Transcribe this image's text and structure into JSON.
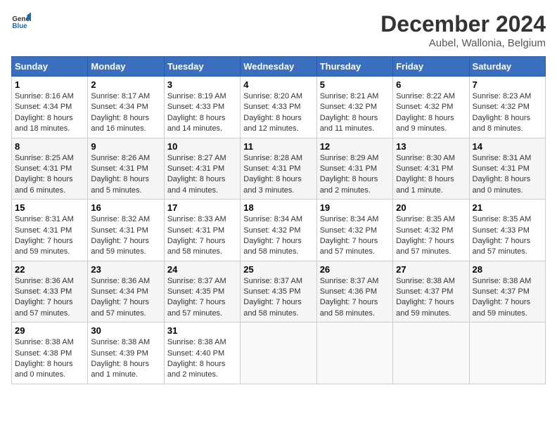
{
  "header": {
    "logo_general": "General",
    "logo_blue": "Blue",
    "title": "December 2024",
    "subtitle": "Aubel, Wallonia, Belgium"
  },
  "days_of_week": [
    "Sunday",
    "Monday",
    "Tuesday",
    "Wednesday",
    "Thursday",
    "Friday",
    "Saturday"
  ],
  "weeks": [
    [
      {
        "day": "1",
        "sunrise": "8:16 AM",
        "sunset": "4:34 PM",
        "daylight": "8 hours and 18 minutes."
      },
      {
        "day": "2",
        "sunrise": "8:17 AM",
        "sunset": "4:34 PM",
        "daylight": "8 hours and 16 minutes."
      },
      {
        "day": "3",
        "sunrise": "8:19 AM",
        "sunset": "4:33 PM",
        "daylight": "8 hours and 14 minutes."
      },
      {
        "day": "4",
        "sunrise": "8:20 AM",
        "sunset": "4:33 PM",
        "daylight": "8 hours and 12 minutes."
      },
      {
        "day": "5",
        "sunrise": "8:21 AM",
        "sunset": "4:32 PM",
        "daylight": "8 hours and 11 minutes."
      },
      {
        "day": "6",
        "sunrise": "8:22 AM",
        "sunset": "4:32 PM",
        "daylight": "8 hours and 9 minutes."
      },
      {
        "day": "7",
        "sunrise": "8:23 AM",
        "sunset": "4:32 PM",
        "daylight": "8 hours and 8 minutes."
      }
    ],
    [
      {
        "day": "8",
        "sunrise": "8:25 AM",
        "sunset": "4:31 PM",
        "daylight": "8 hours and 6 minutes."
      },
      {
        "day": "9",
        "sunrise": "8:26 AM",
        "sunset": "4:31 PM",
        "daylight": "8 hours and 5 minutes."
      },
      {
        "day": "10",
        "sunrise": "8:27 AM",
        "sunset": "4:31 PM",
        "daylight": "8 hours and 4 minutes."
      },
      {
        "day": "11",
        "sunrise": "8:28 AM",
        "sunset": "4:31 PM",
        "daylight": "8 hours and 3 minutes."
      },
      {
        "day": "12",
        "sunrise": "8:29 AM",
        "sunset": "4:31 PM",
        "daylight": "8 hours and 2 minutes."
      },
      {
        "day": "13",
        "sunrise": "8:30 AM",
        "sunset": "4:31 PM",
        "daylight": "8 hours and 1 minute."
      },
      {
        "day": "14",
        "sunrise": "8:31 AM",
        "sunset": "4:31 PM",
        "daylight": "8 hours and 0 minutes."
      }
    ],
    [
      {
        "day": "15",
        "sunrise": "8:31 AM",
        "sunset": "4:31 PM",
        "daylight": "7 hours and 59 minutes."
      },
      {
        "day": "16",
        "sunrise": "8:32 AM",
        "sunset": "4:31 PM",
        "daylight": "7 hours and 59 minutes."
      },
      {
        "day": "17",
        "sunrise": "8:33 AM",
        "sunset": "4:31 PM",
        "daylight": "7 hours and 58 minutes."
      },
      {
        "day": "18",
        "sunrise": "8:34 AM",
        "sunset": "4:32 PM",
        "daylight": "7 hours and 58 minutes."
      },
      {
        "day": "19",
        "sunrise": "8:34 AM",
        "sunset": "4:32 PM",
        "daylight": "7 hours and 57 minutes."
      },
      {
        "day": "20",
        "sunrise": "8:35 AM",
        "sunset": "4:32 PM",
        "daylight": "7 hours and 57 minutes."
      },
      {
        "day": "21",
        "sunrise": "8:35 AM",
        "sunset": "4:33 PM",
        "daylight": "7 hours and 57 minutes."
      }
    ],
    [
      {
        "day": "22",
        "sunrise": "8:36 AM",
        "sunset": "4:33 PM",
        "daylight": "7 hours and 57 minutes."
      },
      {
        "day": "23",
        "sunrise": "8:36 AM",
        "sunset": "4:34 PM",
        "daylight": "7 hours and 57 minutes."
      },
      {
        "day": "24",
        "sunrise": "8:37 AM",
        "sunset": "4:35 PM",
        "daylight": "7 hours and 57 minutes."
      },
      {
        "day": "25",
        "sunrise": "8:37 AM",
        "sunset": "4:35 PM",
        "daylight": "7 hours and 58 minutes."
      },
      {
        "day": "26",
        "sunrise": "8:37 AM",
        "sunset": "4:36 PM",
        "daylight": "7 hours and 58 minutes."
      },
      {
        "day": "27",
        "sunrise": "8:38 AM",
        "sunset": "4:37 PM",
        "daylight": "7 hours and 59 minutes."
      },
      {
        "day": "28",
        "sunrise": "8:38 AM",
        "sunset": "4:37 PM",
        "daylight": "7 hours and 59 minutes."
      }
    ],
    [
      {
        "day": "29",
        "sunrise": "8:38 AM",
        "sunset": "4:38 PM",
        "daylight": "8 hours and 0 minutes."
      },
      {
        "day": "30",
        "sunrise": "8:38 AM",
        "sunset": "4:39 PM",
        "daylight": "8 hours and 1 minute."
      },
      {
        "day": "31",
        "sunrise": "8:38 AM",
        "sunset": "4:40 PM",
        "daylight": "8 hours and 2 minutes."
      },
      null,
      null,
      null,
      null
    ]
  ],
  "labels": {
    "sunrise": "Sunrise:",
    "sunset": "Sunset:",
    "daylight": "Daylight:"
  }
}
